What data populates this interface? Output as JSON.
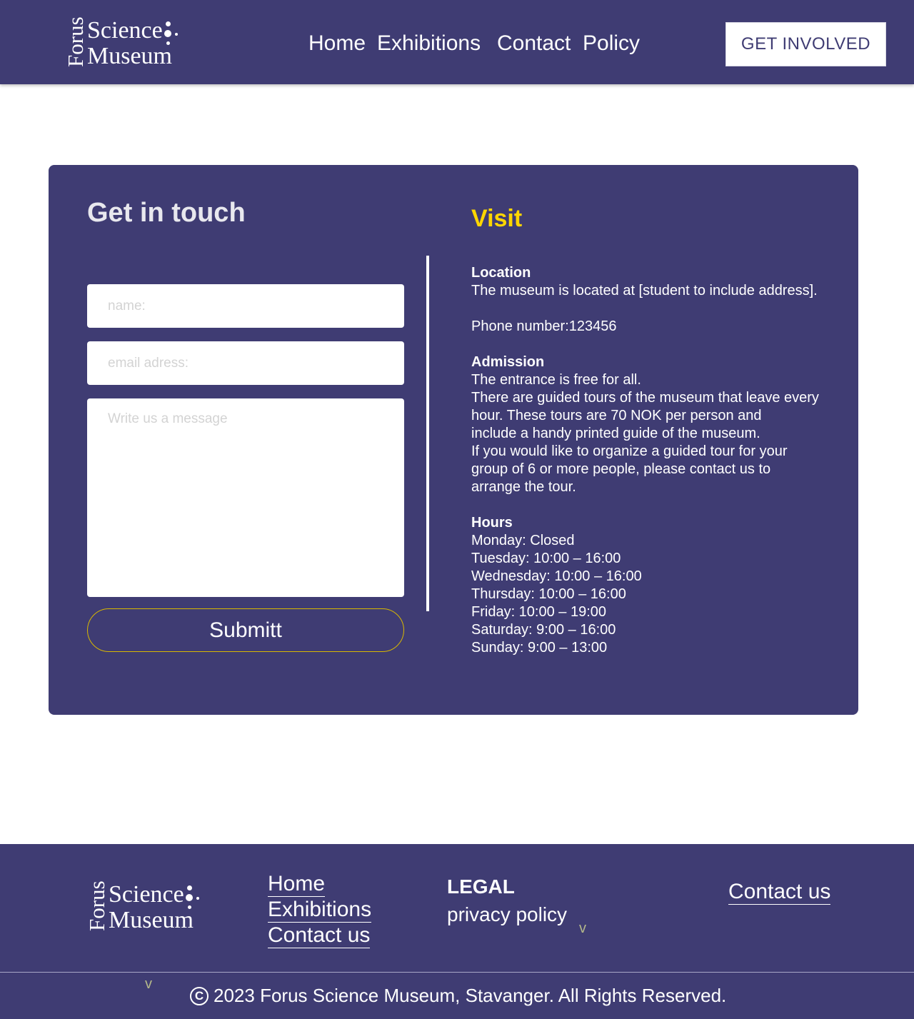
{
  "header": {
    "logo": {
      "forus": "Forus",
      "line1": "Science",
      "line2": "Museum"
    },
    "nav": [
      {
        "label": "Home"
      },
      {
        "label": "Exhibitions"
      },
      {
        "label": "Contact"
      },
      {
        "label": "Policy"
      }
    ],
    "cta_label": "GET INVOLVED"
  },
  "contact_form": {
    "title": "Get in touch",
    "name_placeholder": "name:",
    "email_placeholder": "email adress:",
    "message_placeholder": "Write us a message",
    "submit_label": "Submitt"
  },
  "visit": {
    "title": "Visit",
    "location_heading": "Location",
    "location_text": "The museum is located at [student to include address].",
    "phone_text": "Phone number:123456",
    "admission_heading": "Admission",
    "admission_lines": [
      "The entrance is free for all.",
      "There are guided tours of the museum that leave every",
      "hour. These tours are 70 NOK per person and",
      "include a handy printed guide of the museum.",
      "If you would like to organize a guided tour for your",
      "group of 6 or more people, please contact us to",
      "arrange the tour."
    ],
    "hours_heading": "Hours",
    "hours": [
      "Monday: Closed",
      "Tuesday: 10:00 – 16:00",
      "Wednesday: 10:00 – 16:00",
      "Thursday: 10:00 – 16:00",
      "Friday: 10:00 – 19:00",
      "Saturday: 9:00 – 16:00",
      "Sunday: 9:00 – 13:00"
    ]
  },
  "footer": {
    "logo": {
      "forus": "Forus",
      "line1": "Science",
      "line2": "Museum"
    },
    "links": [
      {
        "label": "Home"
      },
      {
        "label": "Exhibitions"
      },
      {
        "label": "Contact us"
      }
    ],
    "legal_heading": "LEGAL",
    "privacy_label": "privacy policy",
    "chevron_1": "v",
    "chevron_2": "v",
    "contact_label": "Contact us",
    "copyright_symbol": "C",
    "copyright_text": "2023 Forus Science Museum, Stavanger. All Rights Reserved."
  }
}
